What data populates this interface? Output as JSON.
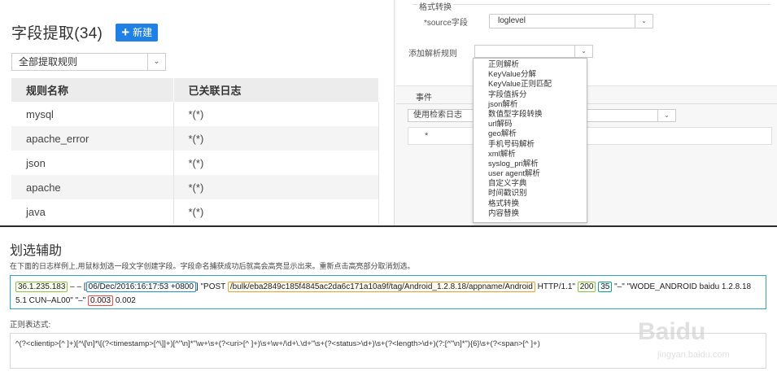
{
  "left_panel": {
    "title": "字段提取(34)",
    "new_button": {
      "icon": "plus-icon",
      "label": "新建"
    },
    "filter_select": {
      "value": "全部提取规则"
    },
    "table": {
      "headers": [
        "规则名称",
        "已关联日志"
      ],
      "rows": [
        [
          "mysql",
          "*(*)"
        ],
        [
          "apache_error",
          "*(*)"
        ],
        [
          "json",
          "*(*)"
        ],
        [
          "apache",
          "*(*)"
        ],
        [
          "java",
          "*(*)"
        ]
      ]
    }
  },
  "right_panel": {
    "format_section_label": "格式转换",
    "source_field_label": "*source字段",
    "source_field_value": "loglevel",
    "add_rule_label": "添加解析规则",
    "tab_label": "事件",
    "search_select_value": "使用检索日志",
    "row_marker": "*",
    "dropdown_items": [
      "正则解析",
      "KeyValue分解",
      "KeyValue正则匹配",
      "字段值拆分",
      "json解析",
      "数值型字段转换",
      "url解码",
      "geo解析",
      "手机号码解析",
      "xml解析",
      "syslog_pri解析",
      "user agent解析",
      "自定义字典",
      "时间戳识别",
      "格式转换",
      "内容替换"
    ]
  },
  "bottom_panel": {
    "title": "划选辅助",
    "description": "在下面的日志样例上,用鼠标划选一段文字创建字段。字段命名捕获成功后就高会高亮显示出来。重新点击高亮部分取消划选。",
    "log_sample": {
      "clientip": "36.1.235.183",
      "sep1": " – – [",
      "timestamp": "06/Dec/2016:16:17:53 +0800",
      "sep2": "] \"POST ",
      "uri": "/bulk/eba2849c185f4845ac2da6c171a10a9f/tag/Android_1.2.8.18/appname/Android",
      "sep3": " HTTP/1.1\" ",
      "status": "200",
      "length": "35",
      "tail1": " \"–\" \"WODE_ANDROID baidu 1.2.8.18 5.1 CUN–AL00\" \"–\" ",
      "highlight_value": "0.003",
      "tail2": " 0.002"
    },
    "regex_label": "正则表达式:",
    "regex_value": "^(?<clientip>[^ ]+)[^\\[\\n]*\\[(?<timestamp>[^\\]]+)[^\"\\n]*\"\\w+\\s+(?<uri>[^ ]+)\\s+\\w+/\\d+\\.\\d+\"\\s+(?<status>\\d+)\\s+(?<length>\\d+)(?:[^\"\\n]*\"){6}\\s+(?<span>[^ ]+)"
  },
  "colors": {
    "primary": "#1f80e6",
    "log_border": "#38a0c8",
    "hl_green": "#8bc34a",
    "hl_blue": "#2b8fc8",
    "hl_orange": "#e6a23c",
    "hl_teal": "#1a9c8c",
    "hl_red": "#d9534f"
  },
  "watermark": {
    "brand": "Baidu",
    "text": "jingyan.baidu.com"
  }
}
